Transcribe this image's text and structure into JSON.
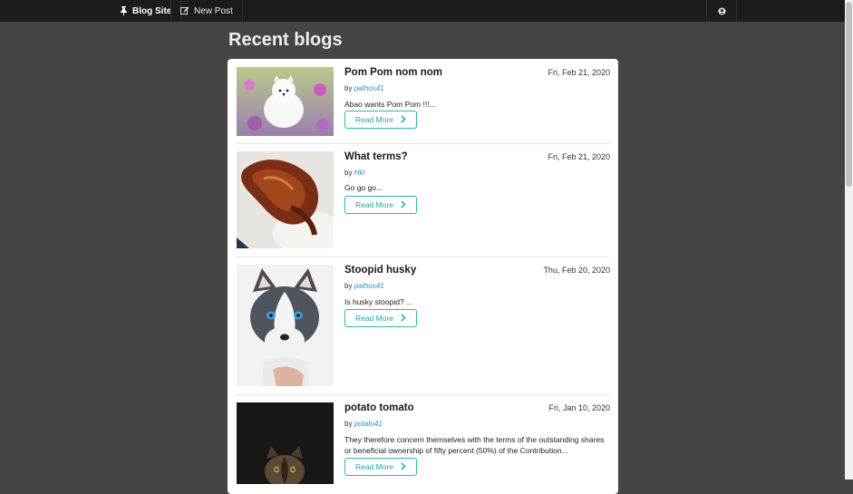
{
  "nav": {
    "brand_label": "Blog Site",
    "new_post_label": "New Post"
  },
  "page": {
    "title": "Recent blogs"
  },
  "posts": [
    {
      "title": "Pom Pom nom nom",
      "date": "Fri, Feb 21, 2020",
      "by": "by",
      "author": "pathos41",
      "excerpt": "Abao wants Pom Pom !!!...",
      "read_more": "Read More",
      "image": "white pomeranian puppy in flowers"
    },
    {
      "title": "What terms?",
      "date": "Fri, Feb 21, 2020",
      "by": "by",
      "author": "Hki",
      "excerpt": "Go go go...",
      "read_more": "Read More",
      "image": "grilled chicken wings"
    },
    {
      "title": "Stoopid husky",
      "date": "Thu, Feb 20, 2020",
      "by": "by",
      "author": "pathos41",
      "excerpt": "Is husky stoopid? ...",
      "read_more": "Read More",
      "image": "husky puppy with blue eyes"
    },
    {
      "title": "potato tomato",
      "date": "Fri, Jan 10, 2020",
      "by": "by",
      "author": "potato41",
      "excerpt": "They therefore concern themselves with the terms of the outstanding shares or beneficial ownership of fifty percent (50%) of the Contribution...",
      "read_more": "Read More",
      "image": "kitten in dark"
    }
  ],
  "colors": {
    "navbar": "#1b1c1d",
    "background": "#454545",
    "accent": "#20a6a8",
    "link": "#2d8fd6"
  }
}
